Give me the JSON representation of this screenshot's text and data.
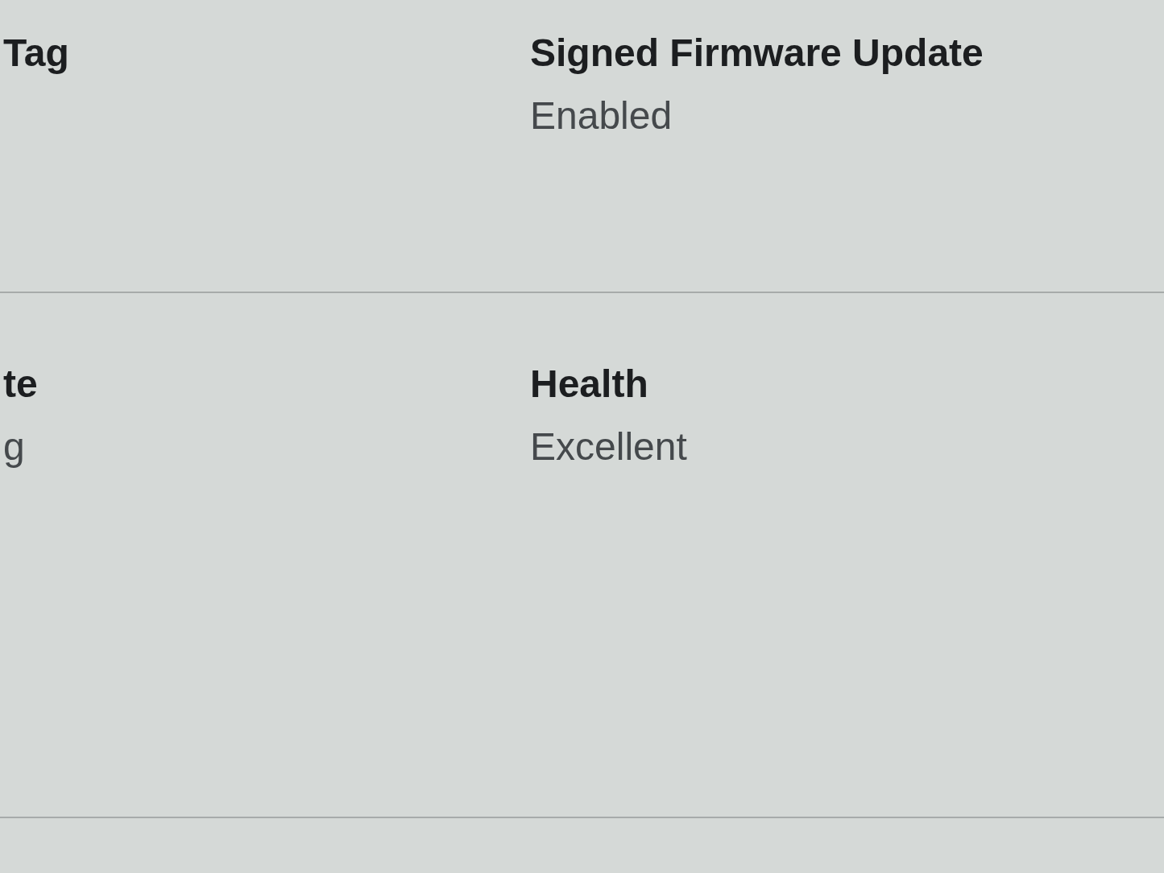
{
  "rows": [
    {
      "fields": [
        {
          "label": "Tag"
        },
        {
          "label": "Signed Firmware Update",
          "value": "Enabled"
        }
      ]
    },
    {
      "fields": [
        {
          "label": "te",
          "value": "g"
        },
        {
          "label": "Health",
          "value": "Excellent"
        }
      ]
    }
  ]
}
